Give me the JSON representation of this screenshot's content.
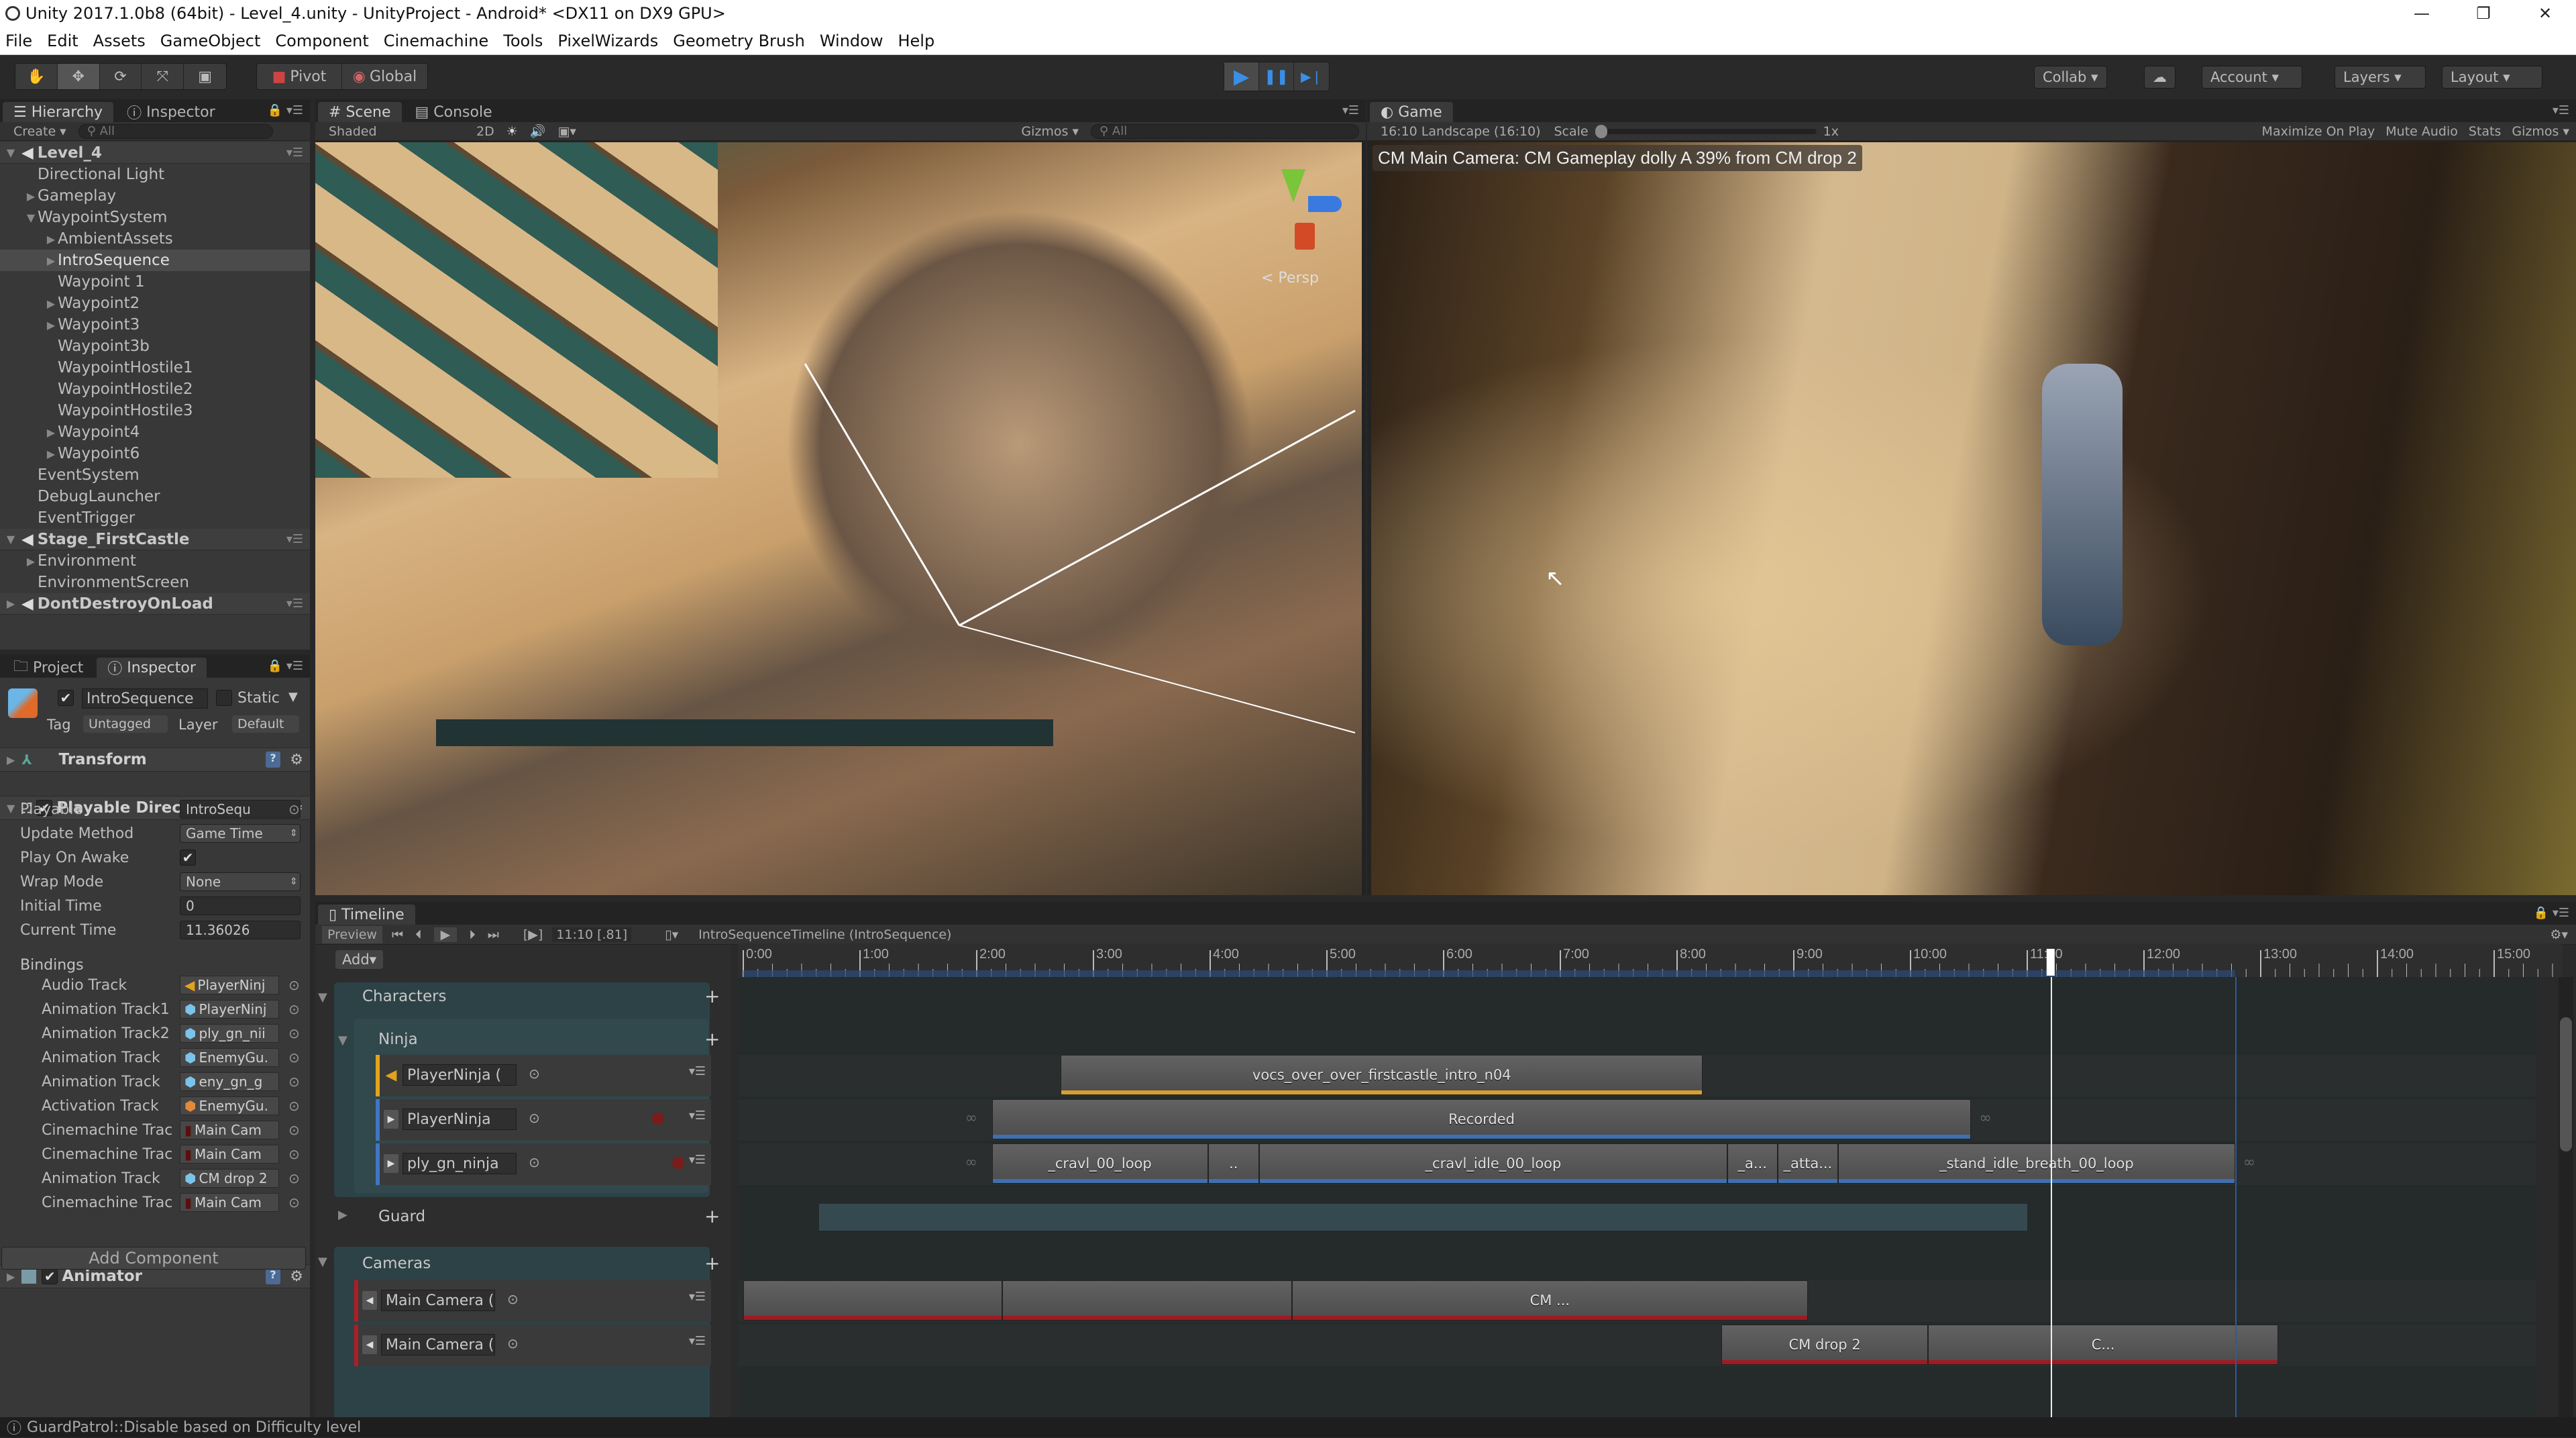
{
  "window": {
    "title": "Unity 2017.1.0b8 (64bit) - Level_4.unity - UnityProject - Android* <DX11 on DX9 GPU>",
    "controls": {
      "minimize": "—",
      "restore": "❐",
      "close": "✕"
    }
  },
  "menu": [
    "File",
    "Edit",
    "Assets",
    "GameObject",
    "Component",
    "Cinemachine",
    "Tools",
    "PixelWizards",
    "Geometry Brush",
    "Window",
    "Help"
  ],
  "toolbar": {
    "tools": [
      {
        "name": "hand-tool",
        "glyph": "✋"
      },
      {
        "name": "move-tool",
        "glyph": "✥"
      },
      {
        "name": "rotate-tool",
        "glyph": "⟳"
      },
      {
        "name": "scale-tool",
        "glyph": "⤧"
      },
      {
        "name": "rect-tool",
        "glyph": "▣"
      }
    ],
    "pivot": "Pivot",
    "global": "Global",
    "play": "▶",
    "pause": "❚❚",
    "step": "▶❘",
    "collab": "Collab ▾",
    "cloud": "☁",
    "account": "Account ▾",
    "layers": "Layers ▾",
    "layout": "Layout ▾"
  },
  "hierarchy": {
    "tabs": [
      "Hierarchy",
      "Inspector"
    ],
    "create": "Create ▾",
    "search_placeholder": "All",
    "items": [
      {
        "label": "Level_4",
        "depth": 0,
        "type": "scene",
        "arrow": "▼"
      },
      {
        "label": "Directional Light",
        "depth": 1,
        "arrow": ""
      },
      {
        "label": "Gameplay",
        "depth": 1,
        "arrow": "▶"
      },
      {
        "label": "WaypointSystem",
        "depth": 1,
        "arrow": "▼"
      },
      {
        "label": "AmbientAssets",
        "depth": 2,
        "arrow": "▶"
      },
      {
        "label": "IntroSequence",
        "depth": 2,
        "arrow": "▶",
        "selected": true
      },
      {
        "label": "Waypoint 1",
        "depth": 2,
        "arrow": ""
      },
      {
        "label": "Waypoint2",
        "depth": 2,
        "arrow": "▶"
      },
      {
        "label": "Waypoint3",
        "depth": 2,
        "arrow": "▶"
      },
      {
        "label": "Waypoint3b",
        "depth": 2,
        "arrow": ""
      },
      {
        "label": "WaypointHostile1",
        "depth": 2,
        "arrow": ""
      },
      {
        "label": "WaypointHostile2",
        "depth": 2,
        "arrow": ""
      },
      {
        "label": "WaypointHostile3",
        "depth": 2,
        "arrow": ""
      },
      {
        "label": "Waypoint4",
        "depth": 2,
        "arrow": "▶"
      },
      {
        "label": "Waypoint6",
        "depth": 2,
        "arrow": "▶"
      },
      {
        "label": "EventSystem",
        "depth": 1,
        "arrow": ""
      },
      {
        "label": "DebugLauncher",
        "depth": 1,
        "arrow": ""
      },
      {
        "label": "EventTrigger",
        "depth": 1,
        "arrow": ""
      },
      {
        "label": "Stage_FirstCastle",
        "depth": 0,
        "type": "scene",
        "arrow": "▼"
      },
      {
        "label": "Environment",
        "depth": 1,
        "arrow": "▶"
      },
      {
        "label": "EnvironmentScreen",
        "depth": 1,
        "arrow": ""
      },
      {
        "label": "DontDestroyOnLoad",
        "depth": 0,
        "type": "scene",
        "arrow": "▶"
      }
    ]
  },
  "inspector": {
    "tabs": [
      "Project",
      "Inspector"
    ],
    "object_name": "IntroSequence",
    "active": true,
    "static_label": "Static",
    "tag_label": "Tag",
    "tag_value": "Untagged",
    "layer_label": "Layer",
    "layer_value": "Default",
    "components": {
      "transform": "Transform",
      "playable_director": "Playable Director",
      "animator": "Animator"
    },
    "fields": [
      {
        "label": "Playable",
        "value": "IntroSequ",
        "kind": "object"
      },
      {
        "label": "Update Method",
        "value": "Game Time",
        "kind": "dropdown"
      },
      {
        "label": "Play On Awake",
        "value": "✔",
        "kind": "checkbox"
      },
      {
        "label": "Wrap Mode",
        "value": "None",
        "kind": "dropdown"
      },
      {
        "label": "Initial Time",
        "value": "0",
        "kind": "number"
      },
      {
        "label": "Current Time",
        "value": "11.36026",
        "kind": "number"
      }
    ],
    "bindings_label": "Bindings",
    "bindings": [
      {
        "label": "Audio Track",
        "value": "PlayerNinj",
        "icon": "audio"
      },
      {
        "label": "Animation Track1",
        "value": "PlayerNinj",
        "icon": "anim"
      },
      {
        "label": "Animation Track2",
        "value": "ply_gn_nii",
        "icon": "anim"
      },
      {
        "label": "Animation Track",
        "value": "EnemyGu.",
        "icon": "anim"
      },
      {
        "label": "Animation Track",
        "value": "eny_gn_g",
        "icon": "anim"
      },
      {
        "label": "Activation Track",
        "value": "EnemyGu.",
        "icon": "activation"
      },
      {
        "label": "Cinemachine Trac",
        "value": "Main Cam",
        "icon": "camera"
      },
      {
        "label": "Cinemachine Trac",
        "value": "Main Cam",
        "icon": "camera"
      },
      {
        "label": "Animation Track",
        "value": "CM drop 2",
        "icon": "anim"
      },
      {
        "label": "Cinemachine Trac",
        "value": "Main Cam",
        "icon": "camera"
      }
    ],
    "add_component": "Add Component"
  },
  "scene": {
    "tabs": [
      "Scene",
      "Console"
    ],
    "shading": "Shaded",
    "mode2d": "2D",
    "gizmos": "Gizmos ▾",
    "search_placeholder": "All",
    "persp": "< Persp"
  },
  "game": {
    "tab": "Game",
    "aspect": "16:10 Landscape (16:10)",
    "scale_label": "Scale",
    "scale_value": "1x",
    "scale_fraction": 0.0,
    "options": [
      "Maximize On Play",
      "Mute Audio",
      "Stats",
      "Gizmos ▾"
    ],
    "overlay": "CM Main Camera: CM Gameplay dolly A 39% from CM drop 2"
  },
  "timeline": {
    "tab": "Timeline",
    "preview": "Preview",
    "transport": [
      "⏮",
      "⏴",
      "▶",
      "⏵",
      "⏭"
    ],
    "frame_toggle": "[▶]",
    "current_time": "11:10 [.81]",
    "asset_name": "IntroSequenceTimeline (IntroSequence)",
    "add": "Add▾",
    "ruler_labels": [
      "0:00",
      "1:00",
      "2:00",
      "3:00",
      "4:00",
      "5:00",
      "6:00",
      "7:00",
      "8:00",
      "9:00",
      "10:00",
      "11:00",
      "12:00",
      "13:00",
      "14:00",
      "15:00"
    ],
    "playhead_time": 11.2,
    "end_marker_time": 12.78,
    "groups": [
      {
        "label": "Characters",
        "arrow": "▼"
      },
      {
        "label": "Ninja",
        "arrow": "▼"
      },
      {
        "label": "Guard",
        "arrow": "▶"
      },
      {
        "label": "Cameras",
        "arrow": "▼"
      }
    ],
    "tracks": [
      {
        "name": "PlayerNinja (",
        "type": "audio",
        "color": "#e3a31c"
      },
      {
        "name": "PlayerNinja",
        "type": "animation",
        "color": "#3f77c2"
      },
      {
        "name": "ply_gn_ninja",
        "type": "animation",
        "color": "#3f77c2"
      },
      {
        "name": "Main Camera (C",
        "type": "cinemachine",
        "color": "#b01c24"
      },
      {
        "name": "Main Camera (C",
        "type": "cinemachine",
        "color": "#b01c24"
      }
    ],
    "clips": [
      {
        "track": 0,
        "label": "vocs_over_over_firstcastle_intro_n04",
        "start": 2.72,
        "end": 8.22,
        "color": "#d7a02e"
      },
      {
        "track": 1,
        "label": "Recorded",
        "start": 2.13,
        "end": 10.52,
        "color": "#3f6fae"
      },
      {
        "track": 2,
        "label": "_cravl_00_loop",
        "start": 2.13,
        "end": 3.98,
        "color": "#3f6fae"
      },
      {
        "track": 2,
        "label": "..",
        "start": 3.98,
        "end": 4.42,
        "color": "#3f6fae"
      },
      {
        "track": 2,
        "label": "_cravl_idle_00_loop",
        "start": 4.42,
        "end": 8.43,
        "color": "#3f6fae"
      },
      {
        "track": 2,
        "label": "_a...",
        "start": 8.43,
        "end": 8.86,
        "color": "#3f6fae"
      },
      {
        "track": 2,
        "label": "_atta...",
        "start": 8.86,
        "end": 9.38,
        "color": "#3f6fae"
      },
      {
        "track": 2,
        "label": "_stand_idle_breath_00_loop",
        "start": 9.38,
        "end": 12.78,
        "color": "#3f6fae"
      },
      {
        "track": 3,
        "label": "",
        "start": 0.0,
        "end": 2.22,
        "color": "#a01a22"
      },
      {
        "track": 3,
        "label": "",
        "start": 2.22,
        "end": 4.7,
        "color": "#a01a22"
      },
      {
        "track": 3,
        "label": "CM ...",
        "start": 4.7,
        "end": 9.12,
        "color": "#a01a22"
      },
      {
        "track": 4,
        "label": "CM drop 2",
        "start": 8.38,
        "end": 10.15,
        "color": "#a01a22"
      },
      {
        "track": 4,
        "label": "C...",
        "start": 10.15,
        "end": 13.15,
        "color": "#a01a22"
      }
    ],
    "guard_summary": {
      "start": 0.65,
      "end": 11.0
    },
    "infinity": "∞"
  },
  "status": {
    "message": "GuardPatrol::Disable based on Difficulty level"
  }
}
